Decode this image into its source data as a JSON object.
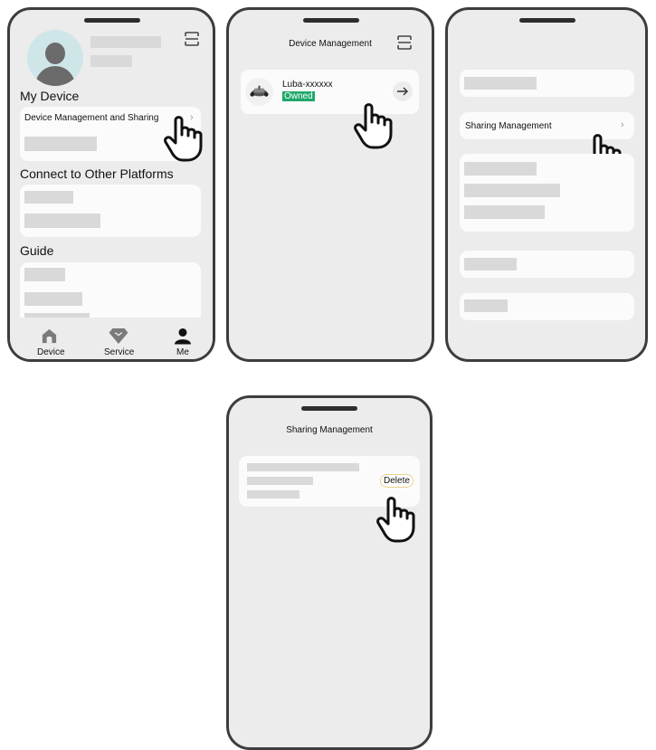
{
  "screen1": {
    "section_my_device": "My Device",
    "menu_device_management": "Device Management and Sharing",
    "section_connect": "Connect to Other Platforms",
    "section_guide": "Guide",
    "tabs": [
      {
        "label": "Device",
        "icon": "home-icon",
        "active": false
      },
      {
        "label": "Service",
        "icon": "diamond-icon",
        "active": false
      },
      {
        "label": "Me",
        "icon": "person-icon",
        "active": true
      }
    ]
  },
  "screen2": {
    "title": "Device Management",
    "device_name": "Luba-xxxxxx",
    "device_status": "Owned",
    "status_color": "#1ea86a"
  },
  "screen3": {
    "menu_sharing": "Sharing Management"
  },
  "screen4": {
    "title": "Sharing Management",
    "delete_label": "Delete",
    "delete_border_color": "#e8d28a"
  }
}
